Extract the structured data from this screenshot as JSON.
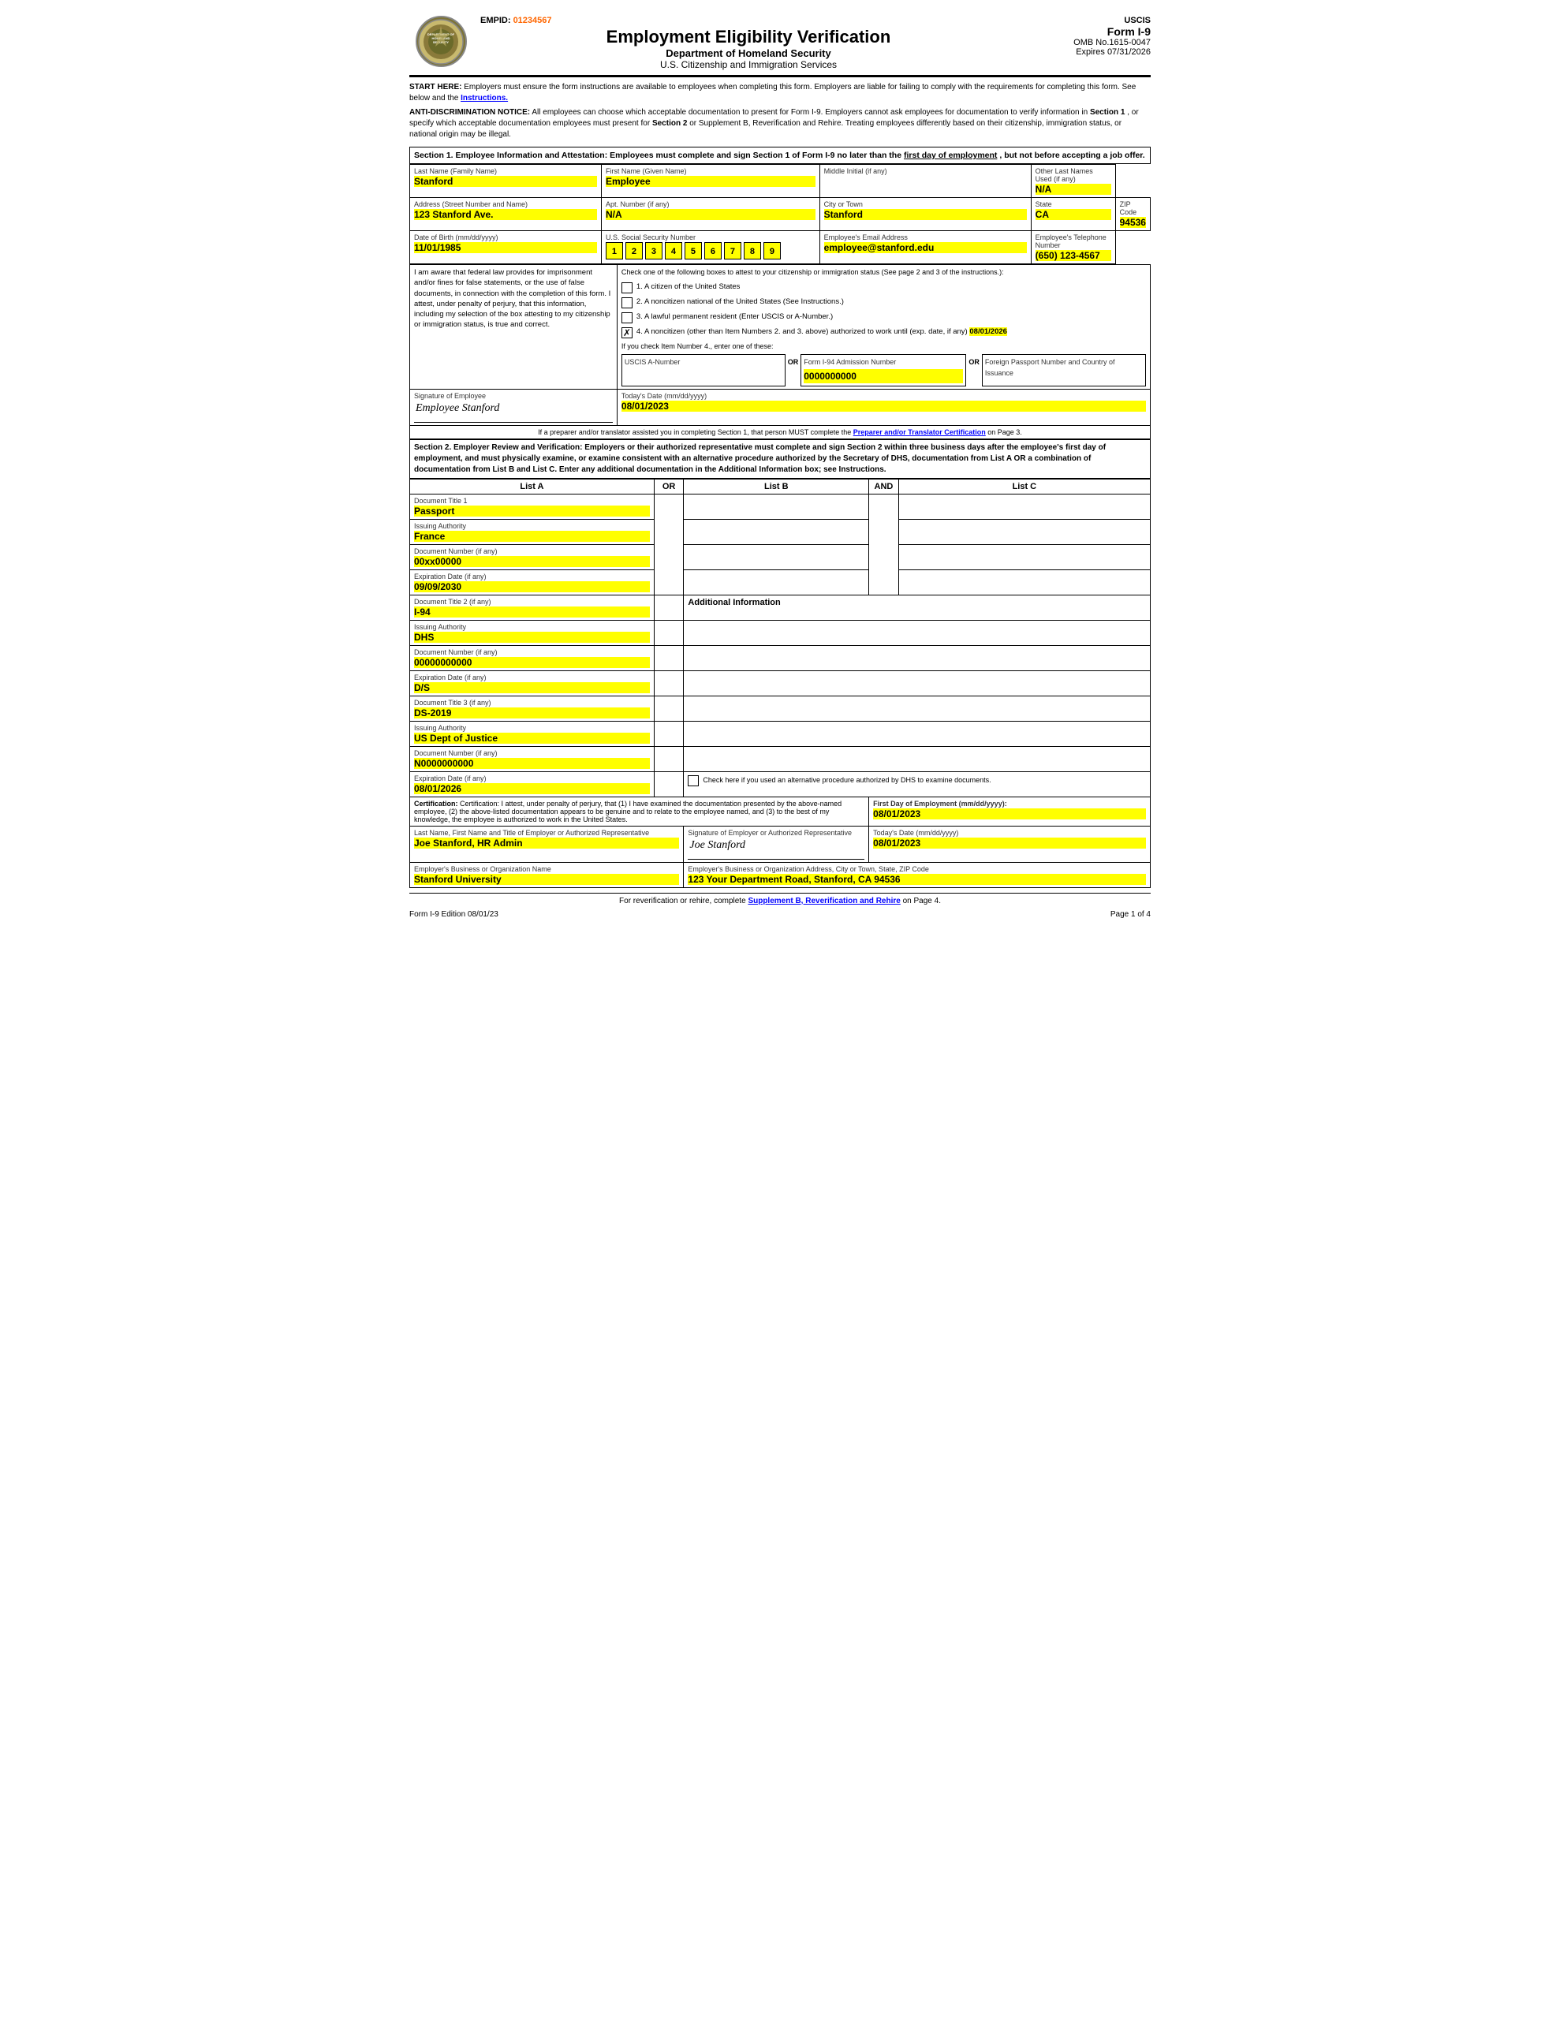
{
  "header": {
    "empid_label": "EMPID:",
    "empid_value": "01234567",
    "form_title": "Employment Eligibility Verification",
    "dept": "Department of Homeland Security",
    "agency": "U.S. Citizenship and Immigration Services",
    "uscis": "USCIS",
    "form_id": "Form I-9",
    "omb": "OMB No.1615-0047",
    "expires": "Expires 07/31/2026"
  },
  "notices": {
    "start_here": "START HERE:  Employers must ensure the form instructions are available to employees when completing this form.  Employers are liable for failing to comply with the requirements for completing this form.  See below and the Instructions.",
    "anti_disc": "ANTI-DISCRIMINATION NOTICE:  All employees can choose which acceptable documentation to present for Form I-9.  Employers cannot ask employees for documentation to verify information in Section 1, or specify which acceptable documentation employees must present for Section 2 or Supplement B, Reverification and Rehire.  Treating employees differently based on their citizenship, immigration status, or national origin may be illegal."
  },
  "section1": {
    "header": "Section 1. Employee Information and Attestation: Employees must complete and sign Section 1 of Form I-9 no later than the first day of employment, but not before accepting a job offer.",
    "last_name_label": "Last Name (Family Name)",
    "last_name": "Stanford",
    "first_name_label": "First Name (Given Name)",
    "first_name": "Employee",
    "middle_initial_label": "Middle Initial (if any)",
    "middle_initial": "",
    "other_names_label": "Other Last Names Used (if any)",
    "other_names": "N/A",
    "address_label": "Address (Street Number and Name)",
    "address": "123 Stanford Ave.",
    "apt_label": "Apt. Number (if any)",
    "apt": "N/A",
    "city_label": "City or Town",
    "city": "Stanford",
    "state_label": "State",
    "state": "CA",
    "zip_label": "ZIP Code",
    "zip": "94536",
    "dob_label": "Date of Birth (mm/dd/yyyy)",
    "dob": "11/01/1985",
    "ssn_label": "U.S. Social Security Number",
    "ssn_digits": [
      "1",
      "2",
      "3",
      "4",
      "5",
      "6",
      "7",
      "8",
      "9"
    ],
    "email_label": "Employee's Email Address",
    "email": "employee@stanford.edu",
    "phone_label": "Employee's Telephone Number",
    "phone": "(650) 123-4567",
    "attestation_left": "I am aware that federal law provides for imprisonment and/or fines for false statements, or the use of false documents, in connection with the completion of this form.  I attest, under penalty of perjury, that this information, including my selection of the box attesting to my citizenship or immigration status, is true and correct.",
    "checkbox1": "1.  A citizen of the United States",
    "checkbox2": "2.  A noncitizen national of the United States (See Instructions.)",
    "checkbox3": "3.  A lawful permanent resident (Enter USCIS or A-Number.)",
    "checkbox4": "4.  A noncitizen (other than Item Numbers 2. and 3. above) authorized to work until (exp. date, if any)",
    "exp_date": "08/01/2026",
    "if_check4": "If you check Item Number 4., enter one of these:",
    "uscis_a_label": "USCIS A-Number",
    "or1": "OR",
    "form94_label": "Form I-94 Admission Number",
    "form94_value": "0000000000",
    "or2": "OR",
    "passport_label": "Foreign Passport Number and Country of Issuance",
    "sig_label": "Signature of Employee",
    "sig_value": "Employee Stanford",
    "date_label": "Today's Date (mm/dd/yyyy)",
    "sig_date": "08/01/2023",
    "preparer_note": "If a preparer and/or translator assisted you in completing Section 1, that person MUST complete the Preparer and/or Translator Certification on Page 3."
  },
  "section2": {
    "header": "Section 2. Employer Review and Verification: Employers or their authorized representative must complete and sign Section 2 within three business days after the employee's first day of employment, and must physically examine, or examine consistent with an alternative procedure authorized by the Secretary of DHS, documentation from List A OR a combination of documentation from List B and List C.  Enter any additional documentation in the Additional Information box; see Instructions.",
    "list_a": "List A",
    "or_label": "OR",
    "list_b": "List B",
    "and_label": "AND",
    "list_c": "List C",
    "doc1_title_label": "Document Title 1",
    "doc1_title": "Passport",
    "issuing1_label": "Issuing Authority",
    "issuing1": "France",
    "docnum1_label": "Document Number (if any)",
    "docnum1": "00xx00000",
    "expdate1_label": "Expiration Date (if any)",
    "expdate1": "09/09/2030",
    "doc2_title_label": "Document Title 2 (if any)",
    "doc2_title": "I-94",
    "add_info_label": "Additional Information",
    "issuing2_label": "Issuing Authority",
    "issuing2": "DHS",
    "docnum2_label": "Document Number (if any)",
    "docnum2": "00000000000",
    "expdate2_label": "Expiration Date (if any)",
    "expdate2": "D/S",
    "doc3_title_label": "Document Title 3 (if any)",
    "doc3_title": "DS-2019",
    "issuing3_label": "Issuing Authority",
    "issuing3": "US Dept of Justice",
    "docnum3_label": "Document Number (if any)",
    "docnum3": "N0000000000",
    "expdate3_label": "Expiration Date (if any)",
    "expdate3": "08/01/2026",
    "alt_proc_label": "Check here if you used an alternative procedure authorized by DHS to examine documents.",
    "cert_text": "Certification: I attest, under penalty of perjury, that (1) I have examined the documentation presented by the above-named employee, (2) the above-listed documentation appears to be genuine and to relate to the employee named, and (3) to the best of my knowledge, the employee is authorized to work in the United States.",
    "first_day_label": "First Day of Employment (mm/dd/yyyy):",
    "first_day": "08/01/2023",
    "rep_name_label": "Last Name, First Name and Title of Employer or Authorized Representative",
    "rep_name": "Joe Stanford, HR Admin",
    "rep_sig_label": "Signature of Employer or Authorized Representative",
    "rep_sig": "Joe Stanford",
    "rep_date_label": "Today's Date (mm/dd/yyyy)",
    "rep_date": "08/01/2023",
    "org_name_label": "Employer's Business or Organization Name",
    "org_name": "Stanford University",
    "org_addr_label": "Employer's Business or Organization Address, City or Town, State, ZIP Code",
    "org_addr": "123 Your Department Road, Stanford, CA 94536"
  },
  "footer": {
    "reverif_note": "For reverification or rehire, complete Supplement B, Reverification and Rehire on Page 4.",
    "edition": "Form I-9  Edition  08/01/23",
    "page": "Page 1 of 4"
  }
}
